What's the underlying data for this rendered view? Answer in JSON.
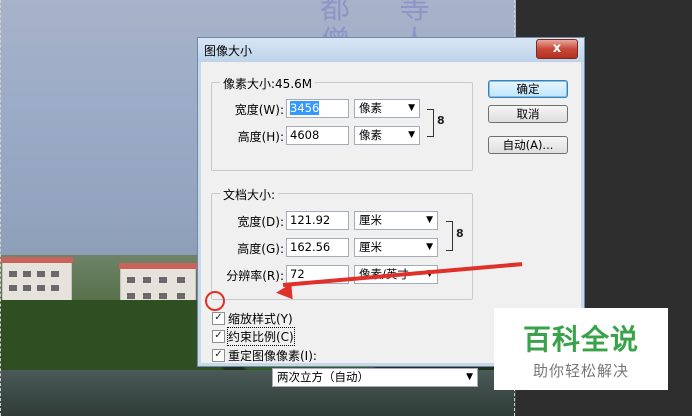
{
  "dialog": {
    "title": "图像大小",
    "close_label": "x",
    "pixel_dimensions": {
      "legend": "像素大小:45.6M",
      "width_label": "宽度(W):",
      "width_value": "3456",
      "width_unit": "像素",
      "height_label": "高度(H):",
      "height_value": "4608",
      "height_unit": "像素"
    },
    "document_size": {
      "legend": "文档大小:",
      "width_label": "宽度(D):",
      "width_value": "121.92",
      "width_unit": "厘米",
      "height_label": "高度(G):",
      "height_value": "162.56",
      "height_unit": "厘米",
      "resolution_label": "分辨率(R):",
      "resolution_value": "72",
      "resolution_unit": "像素/英寸"
    },
    "buttons": {
      "ok": "确定",
      "cancel": "取消",
      "auto": "自动(A)..."
    },
    "options": {
      "scale_styles": "缩放样式(Y)",
      "constrain": "约束比例(C)",
      "resample": "重定图像像素(I):",
      "resample_method": "两次立方（自动）"
    },
    "chain_glyph": "8"
  },
  "watermark": {
    "title": "百科全说",
    "subtitle": "助你轻松解决"
  },
  "background_text": "都 等 僧 人 道 风 书 生"
}
